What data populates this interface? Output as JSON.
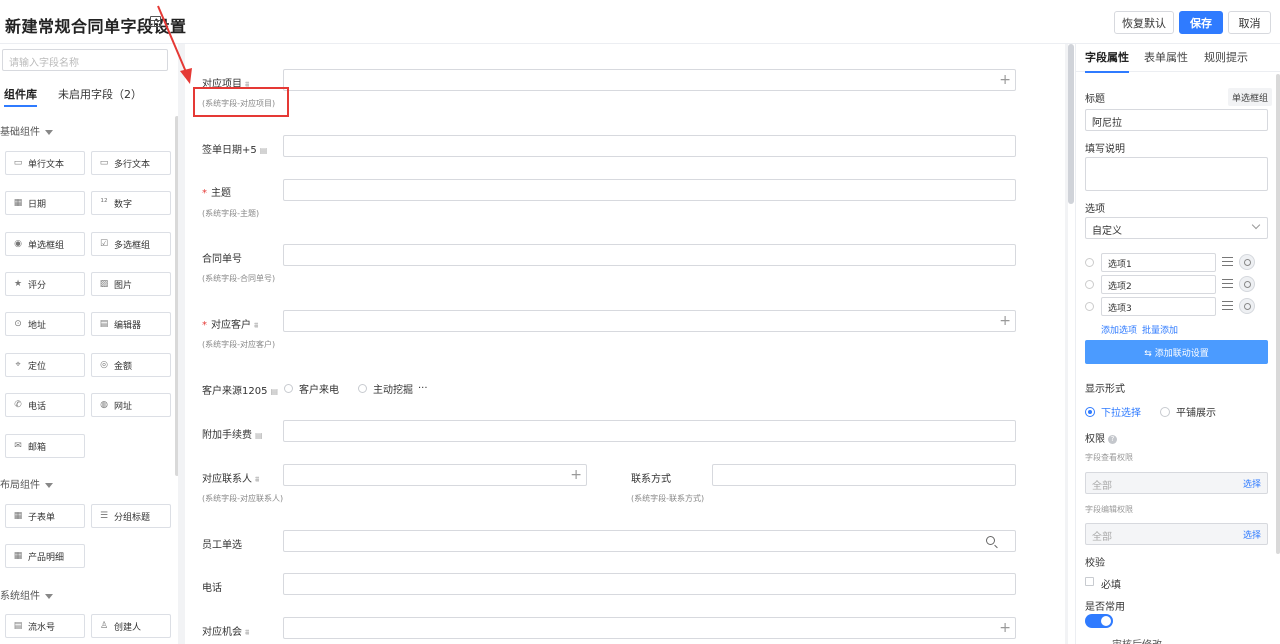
{
  "header": {
    "title": "新建常规合同单字段设置",
    "restore_label": "恢复默认",
    "save_label": "保存",
    "cancel_label": "取消"
  },
  "left": {
    "search_placeholder": "请输入字段名称",
    "tabs": [
      "组件库",
      "未启用字段（2）"
    ],
    "groups": {
      "basic": "基础组件",
      "layout": "布局组件",
      "system": "系统组件"
    },
    "basic_components": [
      {
        "label": "单行文本",
        "icon": "single-line-icon"
      },
      {
        "label": "多行文本",
        "icon": "multi-line-icon"
      },
      {
        "label": "日期",
        "icon": "calendar-icon"
      },
      {
        "label": "数字",
        "icon": "number-icon"
      },
      {
        "label": "单选框组",
        "icon": "radio-icon"
      },
      {
        "label": "多选框组",
        "icon": "checkbox-icon"
      },
      {
        "label": "评分",
        "icon": "star-icon"
      },
      {
        "label": "图片",
        "icon": "image-icon"
      },
      {
        "label": "地址",
        "icon": "location-icon"
      },
      {
        "label": "编辑器",
        "icon": "editor-icon"
      },
      {
        "label": "定位",
        "icon": "pin-icon"
      },
      {
        "label": "金额",
        "icon": "money-icon"
      },
      {
        "label": "电话",
        "icon": "phone-icon"
      },
      {
        "label": "网址",
        "icon": "globe-icon"
      },
      {
        "label": "邮箱",
        "icon": "mail-icon"
      }
    ],
    "layout_components": [
      {
        "label": "子表单",
        "icon": "table-icon"
      },
      {
        "label": "分组标题",
        "icon": "group-title-icon"
      },
      {
        "label": "产品明细",
        "icon": "product-detail-icon"
      }
    ],
    "system_components": [
      {
        "label": "流水号",
        "icon": "serial-icon"
      },
      {
        "label": "创建人",
        "icon": "user-icon"
      }
    ]
  },
  "form": {
    "fields": {
      "project": {
        "label": "对应项目",
        "sub": "(系统字段-对应项目)"
      },
      "sign_date": {
        "label": "签单日期+5"
      },
      "subject": {
        "label": "主题",
        "sub": "(系统字段-主题)",
        "required": "*"
      },
      "contract_no": {
        "label": "合同单号",
        "sub": "(系统字段-合同单号)"
      },
      "customer": {
        "label": "对应客户",
        "sub": "(系统字段-对应客户)",
        "required": "*"
      },
      "source": {
        "label": "客户来源1205",
        "options": [
          "客户来电",
          "主动挖掘"
        ],
        "more": "···"
      },
      "fee": {
        "label": "附加手续费"
      },
      "contact": {
        "label": "对应联系人",
        "sub": "(系统字段-对应联系人)"
      },
      "contact_method": {
        "label": "联系方式",
        "sub": "(系统字段-联系方式)"
      },
      "employee": {
        "label": "员工单选"
      },
      "phone": {
        "label": "电话"
      },
      "opportunity": {
        "label": "对应机会"
      }
    }
  },
  "right": {
    "tabs": [
      "字段属性",
      "表单属性",
      "规则提示"
    ],
    "title_label": "标题",
    "type_tag": "单选框组",
    "title_value": "阿尼拉",
    "desc_label": "填写说明",
    "options_label": "选项",
    "options_mode": "自定义",
    "options": [
      "选项1",
      "选项2",
      "选项3"
    ],
    "add_option": "添加选项",
    "batch_add": "批量添加",
    "linkage_btn": "⇆ 添加联动设置",
    "display_label": "显示形式",
    "display_options": [
      "下拉选择",
      "平铺展示"
    ],
    "perm_label": "权限",
    "view_perm_label": "字段查看权限",
    "view_perm_value": "全部",
    "edit_perm_label": "字段编辑权限",
    "edit_perm_value": "全部",
    "choose": "选择",
    "validate_label": "校验",
    "required_label": "必填",
    "common_label": "是否常用",
    "bottom_text": "审核后修改"
  },
  "colors": {
    "primary": "#2f7bff",
    "annotation": "#e53935"
  }
}
